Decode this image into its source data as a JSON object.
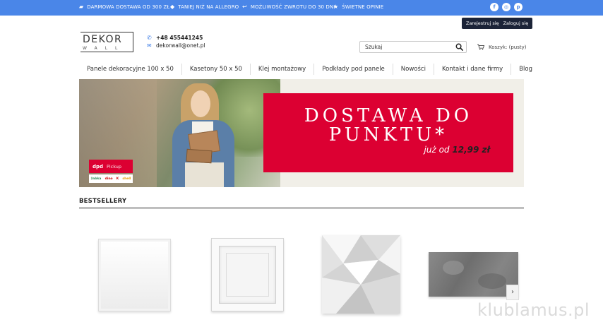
{
  "topbar": {
    "perks": [
      {
        "icon": "truck-icon",
        "label": "DARMOWA DOSTAWA OD 300 ZŁ"
      },
      {
        "icon": "tag-icon",
        "label": "TANIEJ NIŻ NA ALLEGRO"
      },
      {
        "icon": "return-icon",
        "label": "MOŻLIWOŚĆ ZWROTU DO 30 DNI"
      },
      {
        "icon": "star-icon",
        "label": "ŚWIETNE OPINIE"
      }
    ],
    "social": [
      {
        "icon": "facebook-icon",
        "glyph": "f"
      },
      {
        "icon": "instagram-icon",
        "glyph": "◎"
      },
      {
        "icon": "pinterest-icon",
        "glyph": "p"
      }
    ],
    "color": "#4a86e8"
  },
  "auth": {
    "register": "Zarejestruj się",
    "login": "Zaloguj się"
  },
  "logo": {
    "line1": "DEKOR",
    "line2": "WALL"
  },
  "contact": {
    "phone": "+48 455441245",
    "email": "dekorwall@onet.pl"
  },
  "search": {
    "placeholder": "Szukaj"
  },
  "cart": {
    "label": "Koszyk: (pusty)"
  },
  "nav": {
    "items": [
      "Panele dekoracyjne 100 x 50",
      "Kasetony 50 x 50",
      "Klej montażowy",
      "Podkłady pod panele",
      "Nowości",
      "Kontakt i dane firmy",
      "Blog"
    ]
  },
  "banner": {
    "badge": {
      "brand": "dpd",
      "service": "Pickup"
    },
    "partners": [
      "żabka",
      "dino",
      "K",
      "shell"
    ],
    "headline1": "DOSTAWA DO",
    "headline2": "PUNKTU*",
    "sub_prefix": "już od",
    "price": "12,99 zł",
    "accent": "#dc0032"
  },
  "bestsellers": {
    "title": "BESTSELLERY",
    "next": "›"
  },
  "watermark": "klublamus.pl"
}
